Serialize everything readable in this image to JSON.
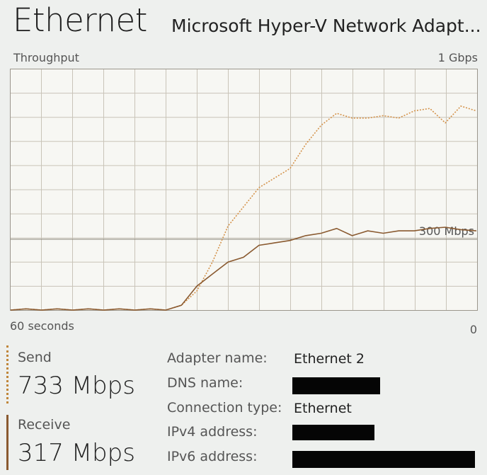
{
  "header": {
    "title": "Ethernet",
    "adapter_description": "Microsoft Hyper-V Network Adapt..."
  },
  "graph": {
    "top_left_label": "Throughput",
    "top_right_label": "1 Gbps",
    "bottom_left_label": "60 seconds",
    "bottom_right_label": "0",
    "scale_marker_label": "300 Mbps"
  },
  "stats": {
    "send_label": "Send",
    "send_value": "733 Mbps",
    "receive_label": "Receive",
    "receive_value": "317 Mbps"
  },
  "properties": [
    {
      "label": "Adapter name:",
      "value": "Ethernet 2"
    },
    {
      "label": "DNS name:",
      "value": null
    },
    {
      "label": "Connection type:",
      "value": "Ethernet"
    },
    {
      "label": "IPv4 address:",
      "value": null
    },
    {
      "label": "IPv6 address:",
      "value": null
    }
  ],
  "colors": {
    "send_line": "#d4924a",
    "receive_line": "#8a5a30",
    "grid": "#c9c4b8",
    "redaction": "#050505"
  },
  "chart_data": {
    "type": "line",
    "title": "Throughput",
    "xlabel": "60 seconds",
    "ylim_top_label": "1 Gbps",
    "x": [
      60,
      58,
      56,
      54,
      52,
      50,
      48,
      46,
      44,
      42,
      40,
      38,
      36,
      34,
      32,
      30,
      28,
      26,
      24,
      22,
      20,
      18,
      16,
      14,
      12,
      10,
      8,
      6,
      4,
      2,
      0
    ],
    "series": [
      {
        "name": "Send",
        "values": [
          0,
          5,
          0,
          5,
          0,
          5,
          0,
          5,
          0,
          5,
          0,
          20,
          80,
          200,
          350,
          430,
          510,
          550,
          590,
          690,
          770,
          820,
          800,
          800,
          810,
          800,
          830,
          840,
          780,
          850,
          830
        ]
      },
      {
        "name": "Receive",
        "values": [
          0,
          5,
          0,
          5,
          0,
          5,
          0,
          5,
          0,
          5,
          0,
          20,
          100,
          150,
          200,
          220,
          270,
          280,
          290,
          310,
          320,
          340,
          310,
          330,
          320,
          330,
          330,
          340,
          345,
          335,
          330
        ]
      }
    ],
    "annotations": [
      "300 Mbps"
    ],
    "grid": true
  }
}
